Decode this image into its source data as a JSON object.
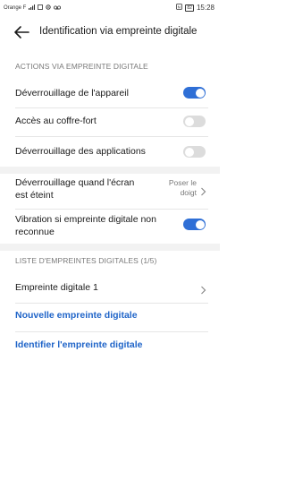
{
  "status_bar": {
    "carrier": "Orange F",
    "battery": "82",
    "time": "15:28"
  },
  "header": {
    "title": "Identification via empreinte digitale"
  },
  "section_actions": {
    "header": "ACTIONS VIA EMPREINTE DIGITALE",
    "items": [
      {
        "label": "Déverrouillage de l'appareil",
        "enabled": true
      },
      {
        "label": "Accès au coffre-fort",
        "enabled": false
      },
      {
        "label": "Déverrouillage des applications",
        "enabled": false
      }
    ]
  },
  "screen_off": {
    "label_line1": "Déverrouillage quand l'écran",
    "label_line2": "est éteint",
    "value_line1": "Poser le",
    "value_line2": "doigt"
  },
  "vibration": {
    "label_line1": "Vibration si empreinte digitale non",
    "label_line2": "reconnue",
    "enabled": true
  },
  "section_list": {
    "header": "LISTE D'EMPREINTES DIGITALES (1/5)",
    "items": [
      {
        "label": "Empreinte digitale 1"
      }
    ],
    "new_link": "Nouvelle empreinte digitale",
    "identify_link": "Identifier l'empreinte digitale"
  },
  "colors": {
    "accent": "#2f6fd6",
    "link": "#1f64c8",
    "toggle_off": "#dcdcdc"
  }
}
